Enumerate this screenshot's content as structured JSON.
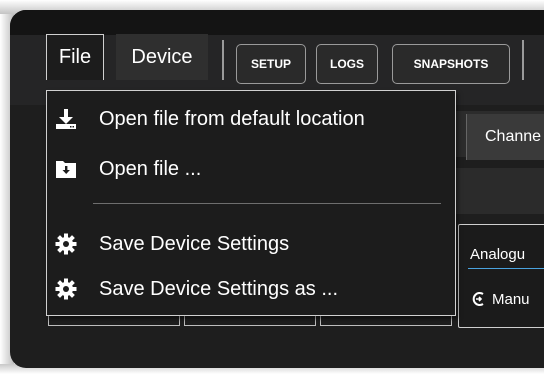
{
  "menubar": {
    "file_label": "File",
    "device_label": "Device"
  },
  "toolbar": {
    "buttons": [
      {
        "label": "SETUP"
      },
      {
        "label": "LOGS"
      },
      {
        "label": "SNAPSHOTS"
      }
    ]
  },
  "background": {
    "channel_label": "Channe",
    "panel_label": "Analogu",
    "panel_mode_label": "Manu"
  },
  "file_menu": {
    "items": [
      {
        "label": "Open file from default location",
        "icon": "download-icon"
      },
      {
        "label": "Open file ...",
        "icon": "folder-download-icon"
      },
      {
        "label": "Save Device Settings",
        "icon": "gear-icon"
      },
      {
        "label": "Save Device Settings as ...",
        "icon": "gear-icon"
      }
    ]
  },
  "colors": {
    "accent": "#4aa3df",
    "background": "#1e1e1e",
    "menu_bg": "#1c1c1c",
    "text": "#ffffff"
  }
}
